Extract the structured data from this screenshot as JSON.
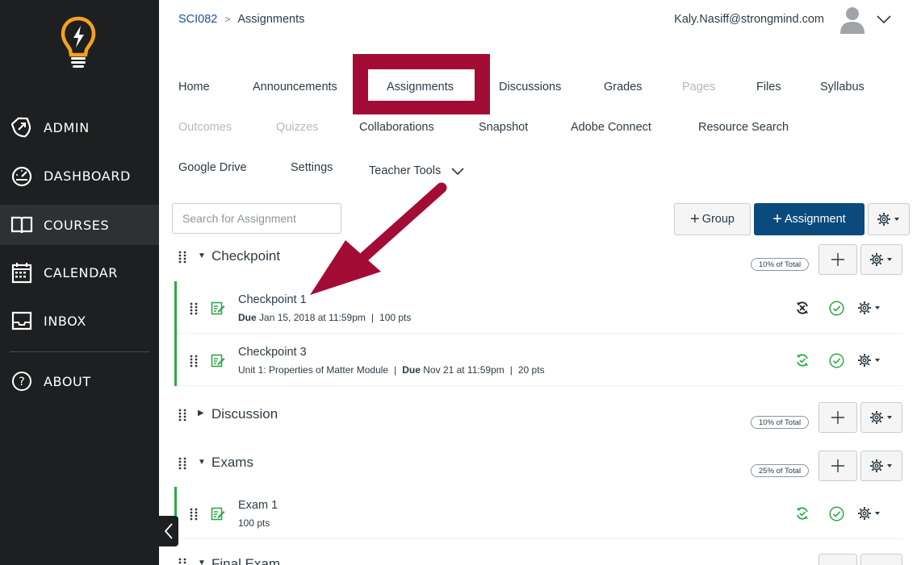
{
  "sidebar": {
    "items": [
      {
        "label": "ADMIN",
        "icon": "admin-shield-icon"
      },
      {
        "label": "DASHBOARD",
        "icon": "dashboard-gauge-icon"
      },
      {
        "label": "COURSES",
        "icon": "courses-book-icon",
        "active": true
      },
      {
        "label": "CALENDAR",
        "icon": "calendar-icon"
      },
      {
        "label": "INBOX",
        "icon": "inbox-tray-icon"
      },
      {
        "label": "ABOUT",
        "icon": "question-circle-icon"
      }
    ]
  },
  "header": {
    "course_code": "SCI082",
    "separator": ">",
    "current_page": "Assignments",
    "user_email": "Kaly.Nasiff@strongmind.com"
  },
  "tabs": {
    "home": "Home",
    "announcements": "Announcements",
    "assignments": "Assignments",
    "discussions": "Discussions",
    "grades": "Grades",
    "pages": "Pages",
    "files": "Files",
    "syllabus": "Syllabus",
    "outcomes": "Outcomes",
    "quizzes": "Quizzes",
    "collaborations": "Collaborations",
    "snapshot": "Snapshot",
    "adobe_connect": "Adobe Connect",
    "resource_search": "Resource Search",
    "google_drive": "Google Drive",
    "settings": "Settings",
    "teacher_tools": "Teacher Tools"
  },
  "toolbar": {
    "search_placeholder": "Search for Assignment",
    "group_button": "Group",
    "assignment_button": "Assignment"
  },
  "groups": [
    {
      "title": "Checkpoint",
      "weight": "10% of Total",
      "items": [
        {
          "name": "Checkpoint 1",
          "due_label": "Due",
          "due": "Jan 15, 2018 at 11:59pm",
          "points": "100 pts"
        },
        {
          "name": "Checkpoint 3",
          "module": "Unit 1: Properties of Matter Module",
          "due_label": "Due",
          "due": "Nov 21 at 11:59pm",
          "points": "20 pts"
        }
      ]
    },
    {
      "title": "Discussion",
      "weight": "10% of Total"
    },
    {
      "title": "Exams",
      "weight": "25% of Total",
      "items": [
        {
          "name": "Exam 1",
          "points": "100 pts"
        }
      ]
    },
    {
      "title": "Final Exam"
    }
  ],
  "colors": {
    "sidebar_bg": "#1e1f21",
    "primary": "#0b4a7d",
    "highlight": "#a30d35",
    "published_green": "#2da844",
    "link": "#1a4fa0"
  }
}
